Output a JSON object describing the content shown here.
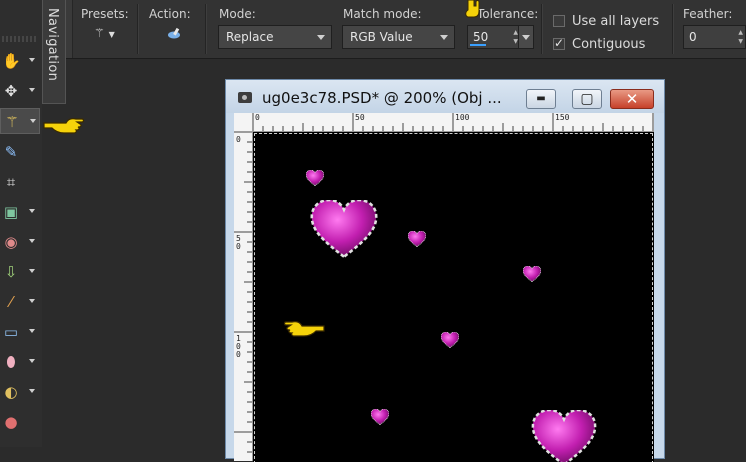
{
  "navigation_tab": {
    "label": "Navigation"
  },
  "options_bar": {
    "presets_label": "Presets:",
    "action_label": "Action:",
    "mode_label": "Mode:",
    "mode_value": "Replace",
    "match_mode_label": "Match mode:",
    "match_mode_value": "RGB Value",
    "tolerance_label": "Tolerance:",
    "tolerance_value": "50",
    "use_all_layers_label": "Use all layers",
    "use_all_layers_checked": false,
    "contiguous_label": "Contiguous",
    "contiguous_checked": true,
    "feather_label": "Feather:",
    "feather_value": "0"
  },
  "toolbar": {
    "tools": [
      {
        "name": "pan-tool",
        "icon": "hand-icon",
        "has_dropdown": true,
        "active": false
      },
      {
        "name": "move-tool",
        "icon": "move-arrows-icon",
        "has_dropdown": true,
        "active": false
      },
      {
        "name": "magic-wand-tool",
        "icon": "magic-wand-icon",
        "has_dropdown": true,
        "active": true
      },
      {
        "name": "dropper-tool",
        "icon": "dropper-icon",
        "has_dropdown": false,
        "active": false
      },
      {
        "name": "crop-tool",
        "icon": "crop-icon",
        "has_dropdown": false,
        "active": false
      },
      {
        "name": "picture-tube-tool",
        "icon": "picture-icon",
        "has_dropdown": true,
        "active": false
      },
      {
        "name": "red-eye-tool",
        "icon": "eye-icon",
        "has_dropdown": true,
        "active": false
      },
      {
        "name": "makeover-tool",
        "icon": "makeover-icon",
        "has_dropdown": true,
        "active": false
      },
      {
        "name": "paint-brush-tool",
        "icon": "brush-icon",
        "has_dropdown": true,
        "active": false
      },
      {
        "name": "clone-tool",
        "icon": "clone-icon",
        "has_dropdown": true,
        "active": false
      },
      {
        "name": "eraser-tool",
        "icon": "eraser-icon",
        "has_dropdown": true,
        "active": false
      },
      {
        "name": "flood-fill-tool",
        "icon": "flood-fill-icon",
        "has_dropdown": true,
        "active": false
      },
      {
        "name": "warp-tool",
        "icon": "warp-icon",
        "has_dropdown": false,
        "active": false
      }
    ]
  },
  "document_window": {
    "title": "ug0e3c78.PSD* @ 200% (Obj ...",
    "minimize_label": "▬",
    "maximize_label": "▢",
    "close_label": "✕",
    "ruler_top_labels": [
      "0",
      "50",
      "100",
      "150"
    ],
    "ruler_left_labels": [
      "0",
      "50",
      "100"
    ]
  },
  "colors": {
    "app_bg": "#2b2b2b",
    "canvas_bg": "#000000",
    "heart": "#c21fb0",
    "pointer": "#f5d20a"
  }
}
